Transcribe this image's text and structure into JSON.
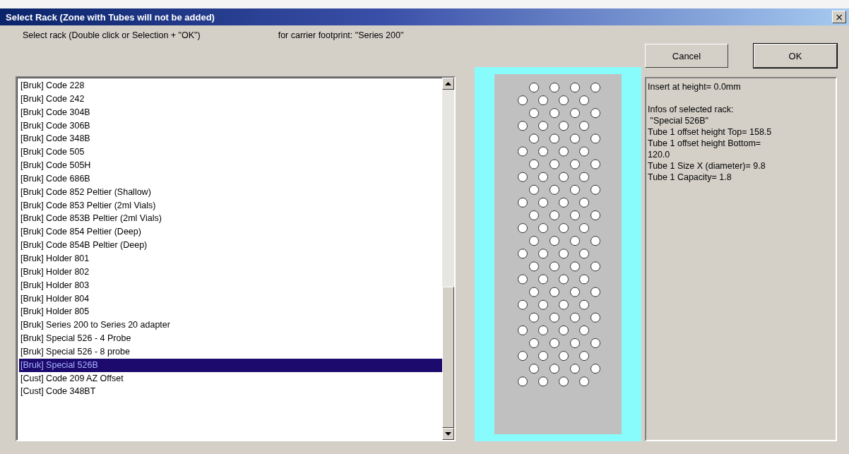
{
  "window": {
    "title": "Select Rack (Zone with Tubes will not be added)",
    "close": "×"
  },
  "instruction": "Select rack (Double click or Selection + \"OK\")",
  "footprint": "for carrier footprint: \"Series 200\"",
  "buttons": [
    {
      "label": "Cancel",
      "default": false
    },
    {
      "label": "OK",
      "default": true
    }
  ],
  "racks": [
    {
      "label": "[Bruk] Code 228",
      "selected": false
    },
    {
      "label": "[Bruk] Code 242",
      "selected": false
    },
    {
      "label": "[Bruk] Code 304B",
      "selected": false
    },
    {
      "label": "[Bruk] Code 306B",
      "selected": false
    },
    {
      "label": "[Bruk] Code 348B",
      "selected": false
    },
    {
      "label": "[Bruk] Code 505",
      "selected": false
    },
    {
      "label": "[Bruk] Code 505H",
      "selected": false
    },
    {
      "label": "[Bruk] Code 686B",
      "selected": false
    },
    {
      "label": "[Bruk] Code 852 Peltier (Shallow)",
      "selected": false
    },
    {
      "label": "[Bruk] Code 853 Peltier (2ml Vials)",
      "selected": false
    },
    {
      "label": "[Bruk] Code 853B Peltier (2ml Vials)",
      "selected": false
    },
    {
      "label": "[Bruk] Code 854 Peltier (Deep)",
      "selected": false
    },
    {
      "label": "[Bruk] Code 854B Peltier (Deep)",
      "selected": false
    },
    {
      "label": "[Bruk] Holder 801",
      "selected": false
    },
    {
      "label": "[Bruk] Holder 802",
      "selected": false
    },
    {
      "label": "[Bruk] Holder 803",
      "selected": false
    },
    {
      "label": "[Bruk] Holder 804",
      "selected": false
    },
    {
      "label": "[Bruk] Holder 805",
      "selected": false
    },
    {
      "label": "[Bruk] Series 200 to Series 20 adapter",
      "selected": false
    },
    {
      "label": "[Bruk] Special 526 - 4 Probe",
      "selected": false
    },
    {
      "label": "[Bruk] Special 526 - 8 probe",
      "selected": false
    },
    {
      "label": "[Bruk] Special 526B",
      "selected": true
    },
    {
      "label": "[Cust] Code 209 AZ Offset",
      "selected": false
    },
    {
      "label": "[Cust] Code 348BT",
      "selected": false
    }
  ],
  "info": {
    "insert": "Insert at height= 0.0mm",
    "details": [
      "Infos of selected rack:",
      " \"Special 526B\"",
      "Tube 1 offset height Top= 158.5",
      "Tube 1 offset height Bottom=",
      "120.0",
      "Tube 1 Size X (diameter)= 9.8",
      "Tube 1 Capacity= 1.8"
    ]
  }
}
